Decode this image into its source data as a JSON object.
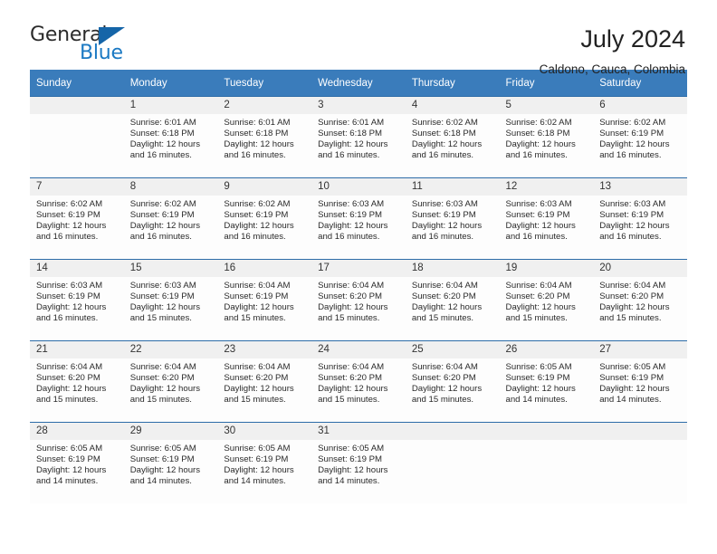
{
  "brand": {
    "name_part1": "General",
    "name_part2": "Blue",
    "logo_icon": "triangle-logo-icon"
  },
  "header": {
    "title": "July 2024",
    "subtitle": "Caldono, Cauca, Colombia"
  },
  "colors": {
    "header_blue": "#3a7cbb",
    "row_divider_blue": "#2d6ca8",
    "daynum_band": "#f0f0f0",
    "brand_blue": "#1b79c3"
  },
  "calendar": {
    "weekday_headers": [
      "Sunday",
      "Monday",
      "Tuesday",
      "Wednesday",
      "Thursday",
      "Friday",
      "Saturday"
    ],
    "weeks": [
      [
        {
          "day": "",
          "sunrise": "",
          "sunset": "",
          "daylight_line1": "",
          "daylight_line2": ""
        },
        {
          "day": "1",
          "sunrise": "Sunrise: 6:01 AM",
          "sunset": "Sunset: 6:18 PM",
          "daylight_line1": "Daylight: 12 hours",
          "daylight_line2": "and 16 minutes."
        },
        {
          "day": "2",
          "sunrise": "Sunrise: 6:01 AM",
          "sunset": "Sunset: 6:18 PM",
          "daylight_line1": "Daylight: 12 hours",
          "daylight_line2": "and 16 minutes."
        },
        {
          "day": "3",
          "sunrise": "Sunrise: 6:01 AM",
          "sunset": "Sunset: 6:18 PM",
          "daylight_line1": "Daylight: 12 hours",
          "daylight_line2": "and 16 minutes."
        },
        {
          "day": "4",
          "sunrise": "Sunrise: 6:02 AM",
          "sunset": "Sunset: 6:18 PM",
          "daylight_line1": "Daylight: 12 hours",
          "daylight_line2": "and 16 minutes."
        },
        {
          "day": "5",
          "sunrise": "Sunrise: 6:02 AM",
          "sunset": "Sunset: 6:18 PM",
          "daylight_line1": "Daylight: 12 hours",
          "daylight_line2": "and 16 minutes."
        },
        {
          "day": "6",
          "sunrise": "Sunrise: 6:02 AM",
          "sunset": "Sunset: 6:19 PM",
          "daylight_line1": "Daylight: 12 hours",
          "daylight_line2": "and 16 minutes."
        }
      ],
      [
        {
          "day": "7",
          "sunrise": "Sunrise: 6:02 AM",
          "sunset": "Sunset: 6:19 PM",
          "daylight_line1": "Daylight: 12 hours",
          "daylight_line2": "and 16 minutes."
        },
        {
          "day": "8",
          "sunrise": "Sunrise: 6:02 AM",
          "sunset": "Sunset: 6:19 PM",
          "daylight_line1": "Daylight: 12 hours",
          "daylight_line2": "and 16 minutes."
        },
        {
          "day": "9",
          "sunrise": "Sunrise: 6:02 AM",
          "sunset": "Sunset: 6:19 PM",
          "daylight_line1": "Daylight: 12 hours",
          "daylight_line2": "and 16 minutes."
        },
        {
          "day": "10",
          "sunrise": "Sunrise: 6:03 AM",
          "sunset": "Sunset: 6:19 PM",
          "daylight_line1": "Daylight: 12 hours",
          "daylight_line2": "and 16 minutes."
        },
        {
          "day": "11",
          "sunrise": "Sunrise: 6:03 AM",
          "sunset": "Sunset: 6:19 PM",
          "daylight_line1": "Daylight: 12 hours",
          "daylight_line2": "and 16 minutes."
        },
        {
          "day": "12",
          "sunrise": "Sunrise: 6:03 AM",
          "sunset": "Sunset: 6:19 PM",
          "daylight_line1": "Daylight: 12 hours",
          "daylight_line2": "and 16 minutes."
        },
        {
          "day": "13",
          "sunrise": "Sunrise: 6:03 AM",
          "sunset": "Sunset: 6:19 PM",
          "daylight_line1": "Daylight: 12 hours",
          "daylight_line2": "and 16 minutes."
        }
      ],
      [
        {
          "day": "14",
          "sunrise": "Sunrise: 6:03 AM",
          "sunset": "Sunset: 6:19 PM",
          "daylight_line1": "Daylight: 12 hours",
          "daylight_line2": "and 16 minutes."
        },
        {
          "day": "15",
          "sunrise": "Sunrise: 6:03 AM",
          "sunset": "Sunset: 6:19 PM",
          "daylight_line1": "Daylight: 12 hours",
          "daylight_line2": "and 15 minutes."
        },
        {
          "day": "16",
          "sunrise": "Sunrise: 6:04 AM",
          "sunset": "Sunset: 6:19 PM",
          "daylight_line1": "Daylight: 12 hours",
          "daylight_line2": "and 15 minutes."
        },
        {
          "day": "17",
          "sunrise": "Sunrise: 6:04 AM",
          "sunset": "Sunset: 6:20 PM",
          "daylight_line1": "Daylight: 12 hours",
          "daylight_line2": "and 15 minutes."
        },
        {
          "day": "18",
          "sunrise": "Sunrise: 6:04 AM",
          "sunset": "Sunset: 6:20 PM",
          "daylight_line1": "Daylight: 12 hours",
          "daylight_line2": "and 15 minutes."
        },
        {
          "day": "19",
          "sunrise": "Sunrise: 6:04 AM",
          "sunset": "Sunset: 6:20 PM",
          "daylight_line1": "Daylight: 12 hours",
          "daylight_line2": "and 15 minutes."
        },
        {
          "day": "20",
          "sunrise": "Sunrise: 6:04 AM",
          "sunset": "Sunset: 6:20 PM",
          "daylight_line1": "Daylight: 12 hours",
          "daylight_line2": "and 15 minutes."
        }
      ],
      [
        {
          "day": "21",
          "sunrise": "Sunrise: 6:04 AM",
          "sunset": "Sunset: 6:20 PM",
          "daylight_line1": "Daylight: 12 hours",
          "daylight_line2": "and 15 minutes."
        },
        {
          "day": "22",
          "sunrise": "Sunrise: 6:04 AM",
          "sunset": "Sunset: 6:20 PM",
          "daylight_line1": "Daylight: 12 hours",
          "daylight_line2": "and 15 minutes."
        },
        {
          "day": "23",
          "sunrise": "Sunrise: 6:04 AM",
          "sunset": "Sunset: 6:20 PM",
          "daylight_line1": "Daylight: 12 hours",
          "daylight_line2": "and 15 minutes."
        },
        {
          "day": "24",
          "sunrise": "Sunrise: 6:04 AM",
          "sunset": "Sunset: 6:20 PM",
          "daylight_line1": "Daylight: 12 hours",
          "daylight_line2": "and 15 minutes."
        },
        {
          "day": "25",
          "sunrise": "Sunrise: 6:04 AM",
          "sunset": "Sunset: 6:20 PM",
          "daylight_line1": "Daylight: 12 hours",
          "daylight_line2": "and 15 minutes."
        },
        {
          "day": "26",
          "sunrise": "Sunrise: 6:05 AM",
          "sunset": "Sunset: 6:19 PM",
          "daylight_line1": "Daylight: 12 hours",
          "daylight_line2": "and 14 minutes."
        },
        {
          "day": "27",
          "sunrise": "Sunrise: 6:05 AM",
          "sunset": "Sunset: 6:19 PM",
          "daylight_line1": "Daylight: 12 hours",
          "daylight_line2": "and 14 minutes."
        }
      ],
      [
        {
          "day": "28",
          "sunrise": "Sunrise: 6:05 AM",
          "sunset": "Sunset: 6:19 PM",
          "daylight_line1": "Daylight: 12 hours",
          "daylight_line2": "and 14 minutes."
        },
        {
          "day": "29",
          "sunrise": "Sunrise: 6:05 AM",
          "sunset": "Sunset: 6:19 PM",
          "daylight_line1": "Daylight: 12 hours",
          "daylight_line2": "and 14 minutes."
        },
        {
          "day": "30",
          "sunrise": "Sunrise: 6:05 AM",
          "sunset": "Sunset: 6:19 PM",
          "daylight_line1": "Daylight: 12 hours",
          "daylight_line2": "and 14 minutes."
        },
        {
          "day": "31",
          "sunrise": "Sunrise: 6:05 AM",
          "sunset": "Sunset: 6:19 PM",
          "daylight_line1": "Daylight: 12 hours",
          "daylight_line2": "and 14 minutes."
        },
        {
          "day": "",
          "sunrise": "",
          "sunset": "",
          "daylight_line1": "",
          "daylight_line2": ""
        },
        {
          "day": "",
          "sunrise": "",
          "sunset": "",
          "daylight_line1": "",
          "daylight_line2": ""
        },
        {
          "day": "",
          "sunrise": "",
          "sunset": "",
          "daylight_line1": "",
          "daylight_line2": ""
        }
      ]
    ]
  }
}
